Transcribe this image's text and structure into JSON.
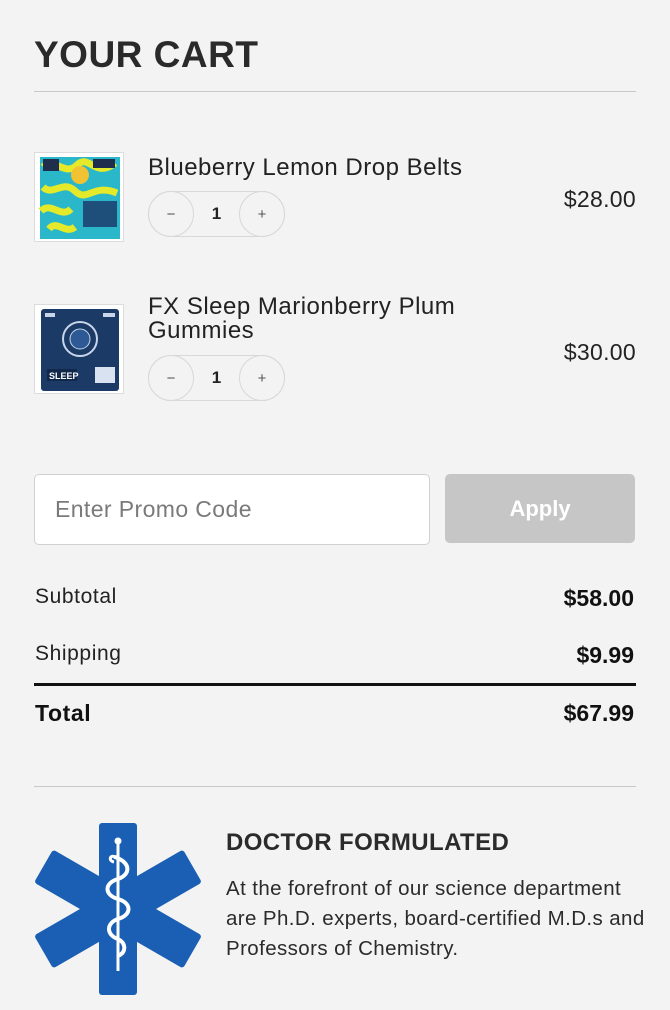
{
  "header": {
    "title": "YOUR CART"
  },
  "cart": {
    "items": [
      {
        "name": "Blueberry Lemon Drop Belts",
        "quantity": "1",
        "price": "$28.00",
        "image_icon": "blueberry-lemon-drop-belts-package-thumbnail"
      },
      {
        "name": "FX Sleep Marionberry Plum Gummies",
        "quantity": "1",
        "price": "$30.00",
        "image_icon": "fx-sleep-gummies-package-thumbnail",
        "package_text": "SLEEP"
      }
    ],
    "stepper": {
      "minus": "−",
      "plus": "+"
    }
  },
  "promo": {
    "placeholder": "Enter Promo Code",
    "apply_label": "Apply"
  },
  "summary": {
    "subtotal_label": "Subtotal",
    "subtotal_value": "$58.00",
    "shipping_label": "Shipping",
    "shipping_value": "$9.99",
    "total_label": "Total",
    "total_value": "$67.99"
  },
  "feature": {
    "icon": "star-of-life-medical-icon",
    "title": "DOCTOR FORMULATED",
    "text": "At the forefront of our science department are Ph.D. experts, board-certified M.D.s and Professors of Chemistry."
  },
  "colors": {
    "background": "#f3f3f3",
    "medical_blue": "#1a5fb4",
    "apply_disabled": "#c6c6c6"
  }
}
